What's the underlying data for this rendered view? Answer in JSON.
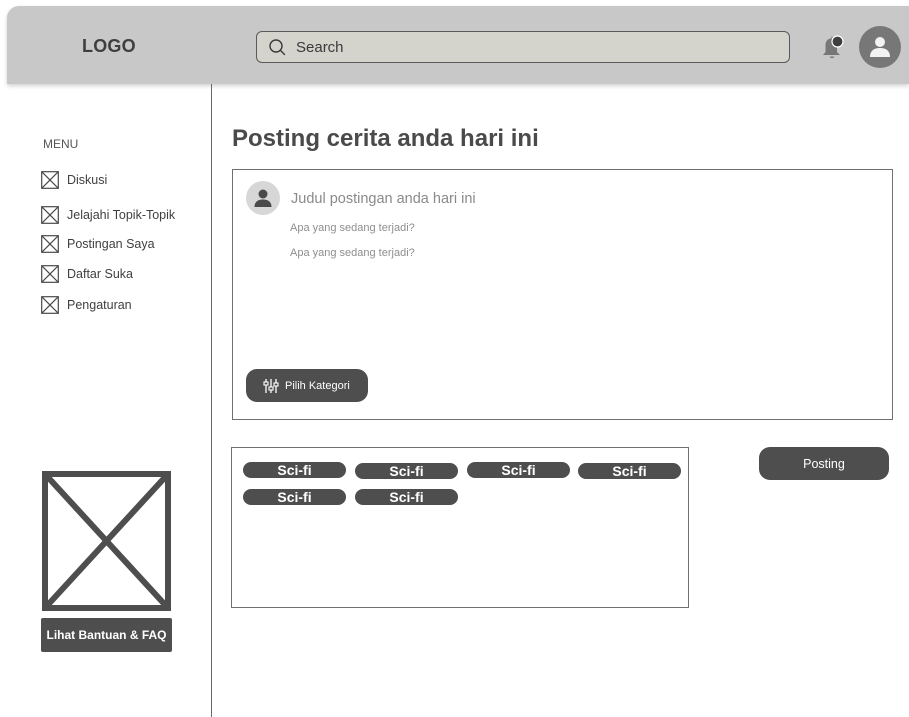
{
  "header": {
    "logo": "LOGO",
    "search": {
      "placeholder": "Search",
      "value": ""
    },
    "icons": {
      "search": "search-icon",
      "notification": "bell-icon",
      "profile": "user-avatar-icon"
    }
  },
  "sidebar": {
    "menu_title": "MENU",
    "items": [
      {
        "label": "Diskusi",
        "icon": "placeholder-x-icon"
      },
      {
        "label": "Jelajahi Topik-Topik",
        "icon": "placeholder-x-icon"
      },
      {
        "label": "Postingan Saya",
        "icon": "placeholder-x-icon"
      },
      {
        "label": "Daftar Suka",
        "icon": "placeholder-x-icon"
      },
      {
        "label": "Pengaturan",
        "icon": "placeholder-x-icon"
      }
    ],
    "help_button": "Lihat Bantuan & FAQ"
  },
  "main": {
    "title": "Posting cerita anda hari ini",
    "compose": {
      "title_placeholder": "Judul postingan anda hari ini",
      "lines": [
        "Apa yang sedang terjadi?",
        "Apa yang sedang terjadi?"
      ],
      "category_button": "Pilih Kategori"
    },
    "tags": [
      "Sci-fi",
      "Sci-fi",
      "Sci-fi",
      "Sci-fi",
      "Sci-fi",
      "Sci-fi"
    ],
    "post_button": "Posting"
  },
  "colors": {
    "header_bg": "#c8c8c8",
    "search_bg": "#d4d4cc",
    "dark_button": "#4e4e4e",
    "avatar": "#777777"
  }
}
